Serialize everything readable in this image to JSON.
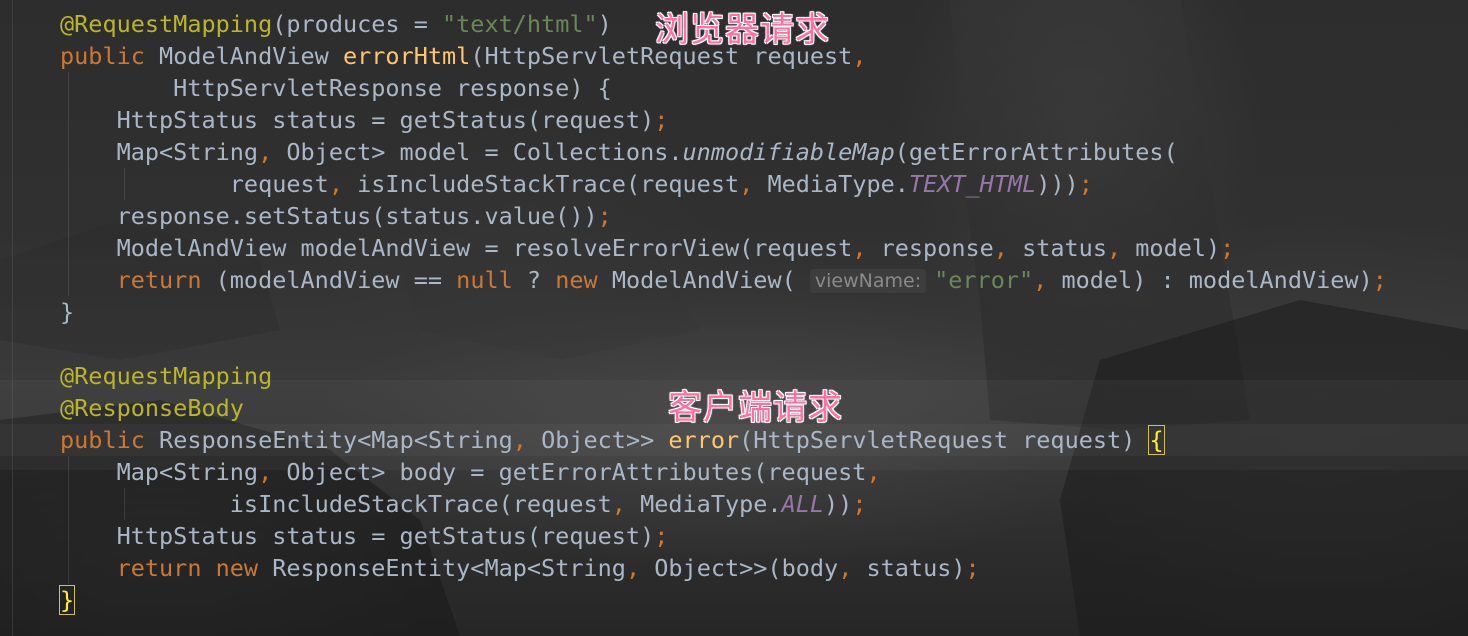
{
  "annotations": {
    "browser_request": "浏览器请求",
    "client_request": "客户端请求"
  },
  "code": {
    "l1_ann": "@RequestMapping",
    "l1_open": "(produces = ",
    "l1_str": "\"text/html\"",
    "l1_close": ")",
    "l2_public": "public ",
    "l2_type": "ModelAndView ",
    "l2_fn": "errorHtml",
    "l2_params": "(HttpServletRequest request",
    "l2_comma": ",",
    "l3_params": "        HttpServletResponse response) {",
    "l4_text": "    HttpStatus status = getStatus(request)",
    "l4_semi": ";",
    "l5_a": "    Map<String",
    "l5_comma": ", ",
    "l5_b": "Object> model = Collections.",
    "l5_ital": "unmodifiableMap",
    "l5_c": "(getErrorAttributes(",
    "l6_a": "            request",
    "l6_comma1": ", ",
    "l6_b": "isIncludeStackTrace(request",
    "l6_comma2": ", ",
    "l6_c": "MediaType.",
    "l6_const": "TEXT_HTML",
    "l6_d": ")))",
    "l6_semi": ";",
    "l7_text": "    response.setStatus(status.value())",
    "l7_semi": ";",
    "l8_a": "    ModelAndView modelAndView = resolveErrorView(request",
    "l8_c1": ", ",
    "l8_b": "response",
    "l8_c2": ", ",
    "l8_c": "status",
    "l8_c3": ", ",
    "l8_d": "model)",
    "l8_semi": ";",
    "l9_return": "    return ",
    "l9_a": "(modelAndView == ",
    "l9_null": "null ",
    "l9_b": "? ",
    "l9_new": "new ",
    "l9_c": "ModelAndView( ",
    "l9_hint": "viewName:",
    "l9_str": "\"error\"",
    "l9_comma": ", ",
    "l9_d": "model) : modelAndView)",
    "l9_semi": ";",
    "l10_close": "}",
    "l12_ann": "@RequestMapping",
    "l13_ann": "@ResponseBody",
    "l14_public": "public ",
    "l14_a": "ResponseEntity<Map<String",
    "l14_comma": ", ",
    "l14_b": "Object>> ",
    "l14_fn": "error",
    "l14_c": "(HttpServletRequest request) ",
    "l14_brace": "{",
    "l15_a": "    Map<String",
    "l15_comma1": ", ",
    "l15_b": "Object> body = getErrorAttributes(request",
    "l15_comma2": ",",
    "l16_a": "            isIncludeStackTrace(request",
    "l16_comma": ", ",
    "l16_b": "MediaType.",
    "l16_const": "ALL",
    "l16_c": "))",
    "l16_semi": ";",
    "l17_text": "    HttpStatus status = getStatus(request)",
    "l17_semi": ";",
    "l18_return": "    return ",
    "l18_new": "new ",
    "l18_a": "ResponseEntity<Map<String",
    "l18_comma": ", ",
    "l18_b": "Object>>(body",
    "l18_comma2": ", ",
    "l18_c": "status)",
    "l18_semi": ";",
    "l19_close": "}"
  },
  "colors": {
    "annotation": "#bbb529",
    "keyword": "#cc7832",
    "string": "#6a8759",
    "function": "#ffc66d",
    "constant": "#9876aa",
    "text": "#a9b7c6",
    "label": "#ff6fa0"
  }
}
